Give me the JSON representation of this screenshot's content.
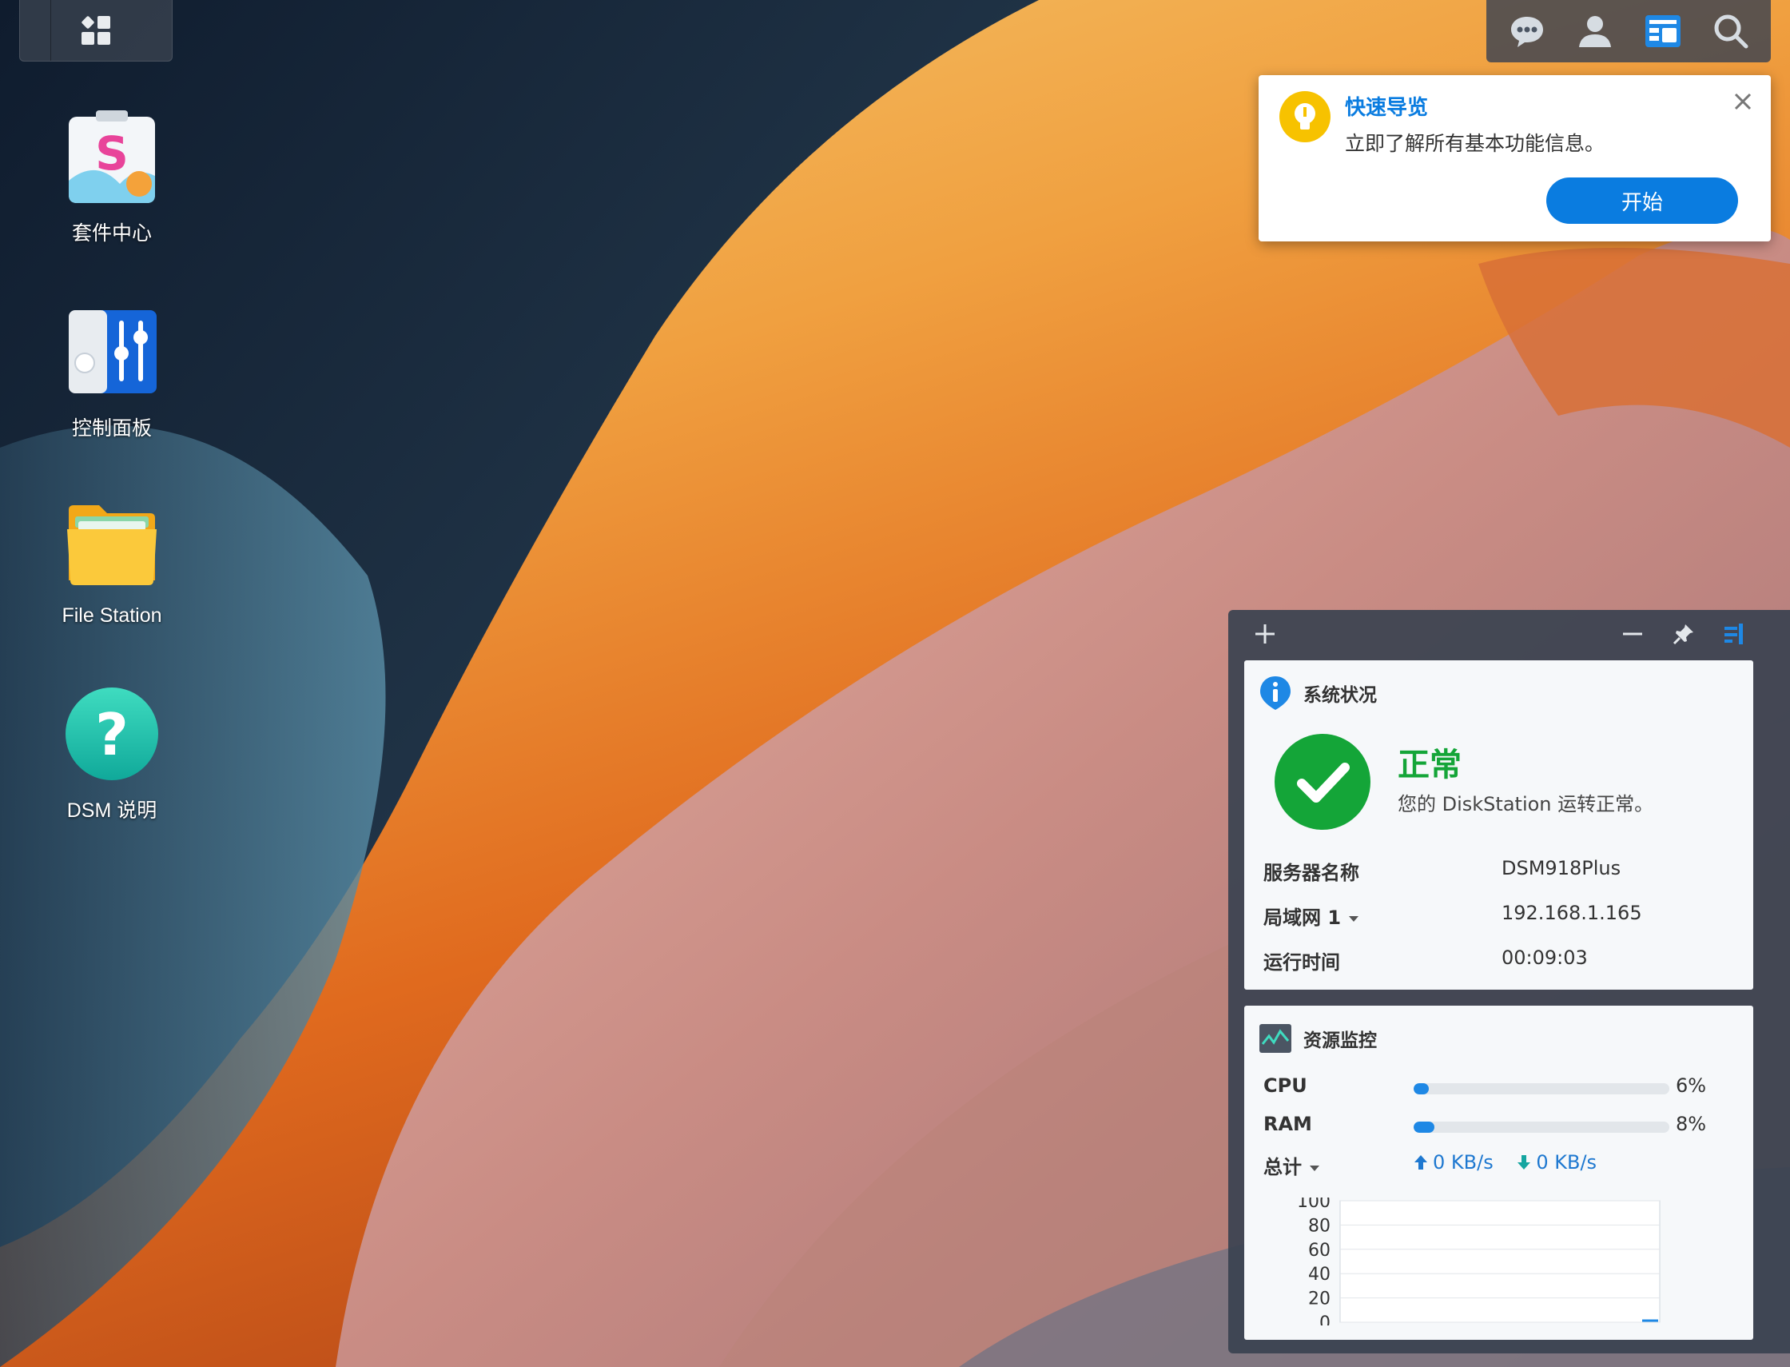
{
  "desktop": {
    "icons": [
      {
        "label": "套件中心",
        "icon": "package-center-icon"
      },
      {
        "label": "控制面板",
        "icon": "control-panel-icon"
      },
      {
        "label": "File Station",
        "icon": "file-station-icon"
      },
      {
        "label": "DSM 说明",
        "icon": "help-icon"
      }
    ]
  },
  "notification": {
    "title": "快速导览",
    "message": "立即了解所有基本功能信息。",
    "button": "开始"
  },
  "system_status": {
    "title": "系统状况",
    "status": "正常",
    "message": "您的 DiskStation 运转正常。",
    "rows": [
      {
        "key": "服务器名称",
        "value": "DSM918Plus"
      },
      {
        "key": "局域网 1",
        "value": "192.168.1.165"
      },
      {
        "key": "运行时间",
        "value": "00:09:03"
      }
    ]
  },
  "resource_monitor": {
    "title": "资源监控",
    "cpu_label": "CPU",
    "cpu_value": "6%",
    "cpu_fraction": 0.06,
    "ram_label": "RAM",
    "ram_value": "8%",
    "ram_fraction": 0.08,
    "net_label": "总计",
    "upload": "0 KB/s",
    "download": "0 KB/s",
    "y_ticks": [
      "100",
      "80",
      "60",
      "40",
      "20",
      "0"
    ]
  },
  "colors": {
    "accent": "#0a7ce0",
    "ok": "#14a538",
    "bulb": "#f7c200"
  }
}
